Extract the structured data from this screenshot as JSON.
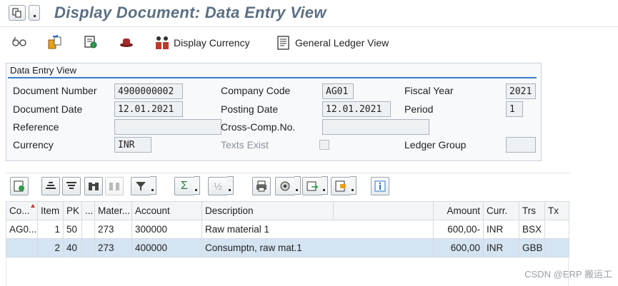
{
  "title": "Display Document: Data Entry View",
  "toolbar": {
    "display_currency": "Display Currency",
    "general_ledger_view": "General Ledger View"
  },
  "group": {
    "title": "Data Entry View",
    "document_number_label": "Document Number",
    "document_number": "4900000002",
    "company_code_label": "Company Code",
    "company_code": "AG01",
    "fiscal_year_label": "Fiscal Year",
    "fiscal_year": "2021",
    "document_date_label": "Document Date",
    "document_date": "12.01.2021",
    "posting_date_label": "Posting Date",
    "posting_date": "12.01.2021",
    "period_label": "Period",
    "period": "1",
    "reference_label": "Reference",
    "reference": "",
    "cross_comp_label": "Cross-Comp.No.",
    "cross_comp": "",
    "currency_label": "Currency",
    "currency": "INR",
    "texts_exist_label": "Texts Exist",
    "ledger_group_label": "Ledger Group",
    "ledger_group": ""
  },
  "alv": {
    "sum_glyph": "Σ",
    "subtotal_glyph": "½"
  },
  "grid": {
    "columns": [
      "Co...",
      "Item",
      "PK",
      "...",
      "Mater...",
      "Account",
      "Description",
      "",
      "Amount",
      "Curr.",
      "Trs",
      "Tx"
    ],
    "rows": [
      {
        "co": "AG0...",
        "item": "1",
        "pk": "50",
        "s": "",
        "mater": "273",
        "account": "300000",
        "description": "Raw material 1",
        "amount": "600,00-",
        "curr": "INR",
        "trs": "BSX",
        "tx": ""
      },
      {
        "co": "",
        "item": "2",
        "pk": "40",
        "s": "",
        "mater": "273",
        "account": "400000",
        "description": "Consumptn, raw mat.1",
        "amount": "600,00",
        "curr": "INR",
        "trs": "GBB",
        "tx": ""
      }
    ]
  },
  "watermark": "CSDN @ERP 搬运工"
}
